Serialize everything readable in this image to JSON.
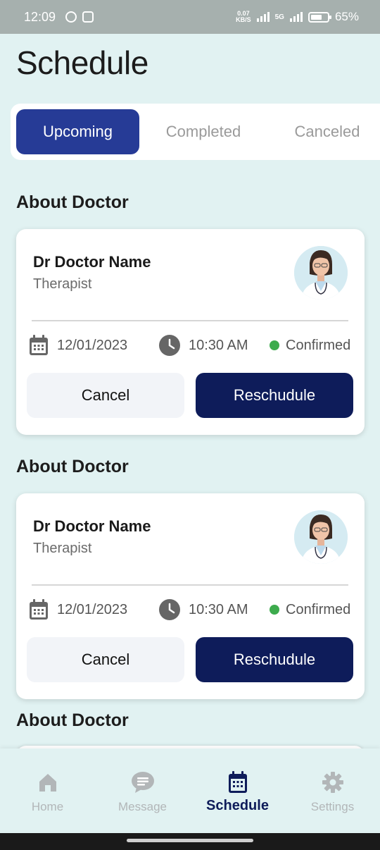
{
  "status_bar": {
    "time": "12:09",
    "net_speed_value": "0.07",
    "net_speed_unit": "KB/S",
    "network": "5G",
    "battery": "65%"
  },
  "page": {
    "title": "Schedule"
  },
  "tabs": [
    {
      "label": "Upcoming",
      "active": true
    },
    {
      "label": "Completed",
      "active": false
    },
    {
      "label": "Canceled",
      "active": false
    }
  ],
  "appointments": [
    {
      "section_title": "About Doctor",
      "doctor_name": "Dr Doctor Name",
      "role": "Therapist",
      "date": "12/01/2023",
      "time": "10:30 AM",
      "status": "Confirmed",
      "cancel_label": "Cancel",
      "reschedule_label": "Reschudule"
    },
    {
      "section_title": "About Doctor",
      "doctor_name": "Dr Doctor Name",
      "role": "Therapist",
      "date": "12/01/2023",
      "time": "10:30 AM",
      "status": "Confirmed",
      "cancel_label": "Cancel",
      "reschedule_label": "Reschudule"
    },
    {
      "section_title": "About Doctor"
    }
  ],
  "bottom_nav": [
    {
      "label": "Home",
      "icon": "home-icon",
      "active": false
    },
    {
      "label": "Message",
      "icon": "message-icon",
      "active": false
    },
    {
      "label": "Schedule",
      "icon": "calendar-icon",
      "active": true
    },
    {
      "label": "Settings",
      "icon": "gear-icon",
      "active": false
    }
  ],
  "colors": {
    "accent": "#263b96",
    "primary_button": "#0e1c5a",
    "background": "#e1f2f2",
    "status_confirmed": "#3dab4d"
  }
}
